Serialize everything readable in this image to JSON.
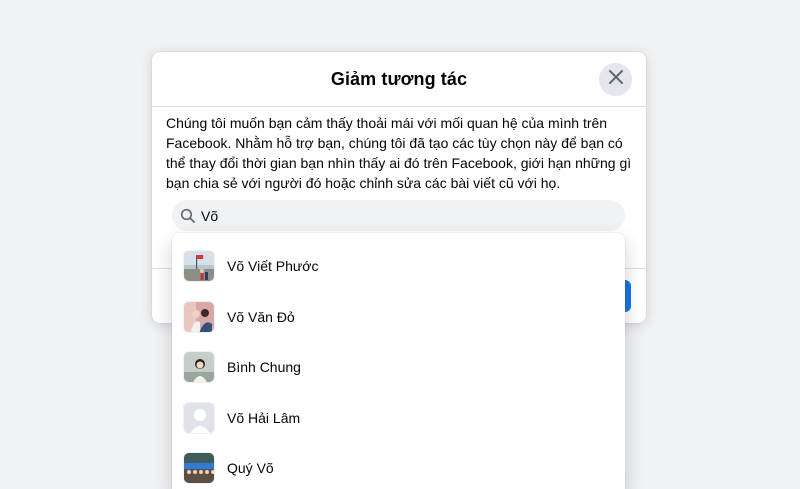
{
  "modal": {
    "title": "Giảm tương tác",
    "description": "Chúng tôi muốn bạn cảm thấy thoải mái với mối quan hệ của mình trên Facebook. Nhằm hỗ trợ bạn, chúng tôi đã tạo các tùy chọn này để bạn có thể thay đổi thời gian bạn nhìn thấy ai đó trên Facebook, giới hạn những gì bạn chia sẻ với người đó hoặc chỉnh sửa các bài viết cũ với họ."
  },
  "search": {
    "value": "Võ",
    "icon": "search-icon"
  },
  "icons": {
    "close": "close-icon"
  },
  "colors": {
    "accent": "#1b74e4",
    "page_bg": "#f0f2f5"
  },
  "results": [
    {
      "name": "Võ Viết Phước",
      "avatar": "photo-landscape-flag"
    },
    {
      "name": "Võ Văn Đỏ",
      "avatar": "photo-couple"
    },
    {
      "name": "Bình Chung",
      "avatar": "photo-portrait"
    },
    {
      "name": "Võ Hải Lâm",
      "avatar": "default-avatar-silhouette"
    },
    {
      "name": "Quý Võ",
      "avatar": "photo-group"
    }
  ]
}
